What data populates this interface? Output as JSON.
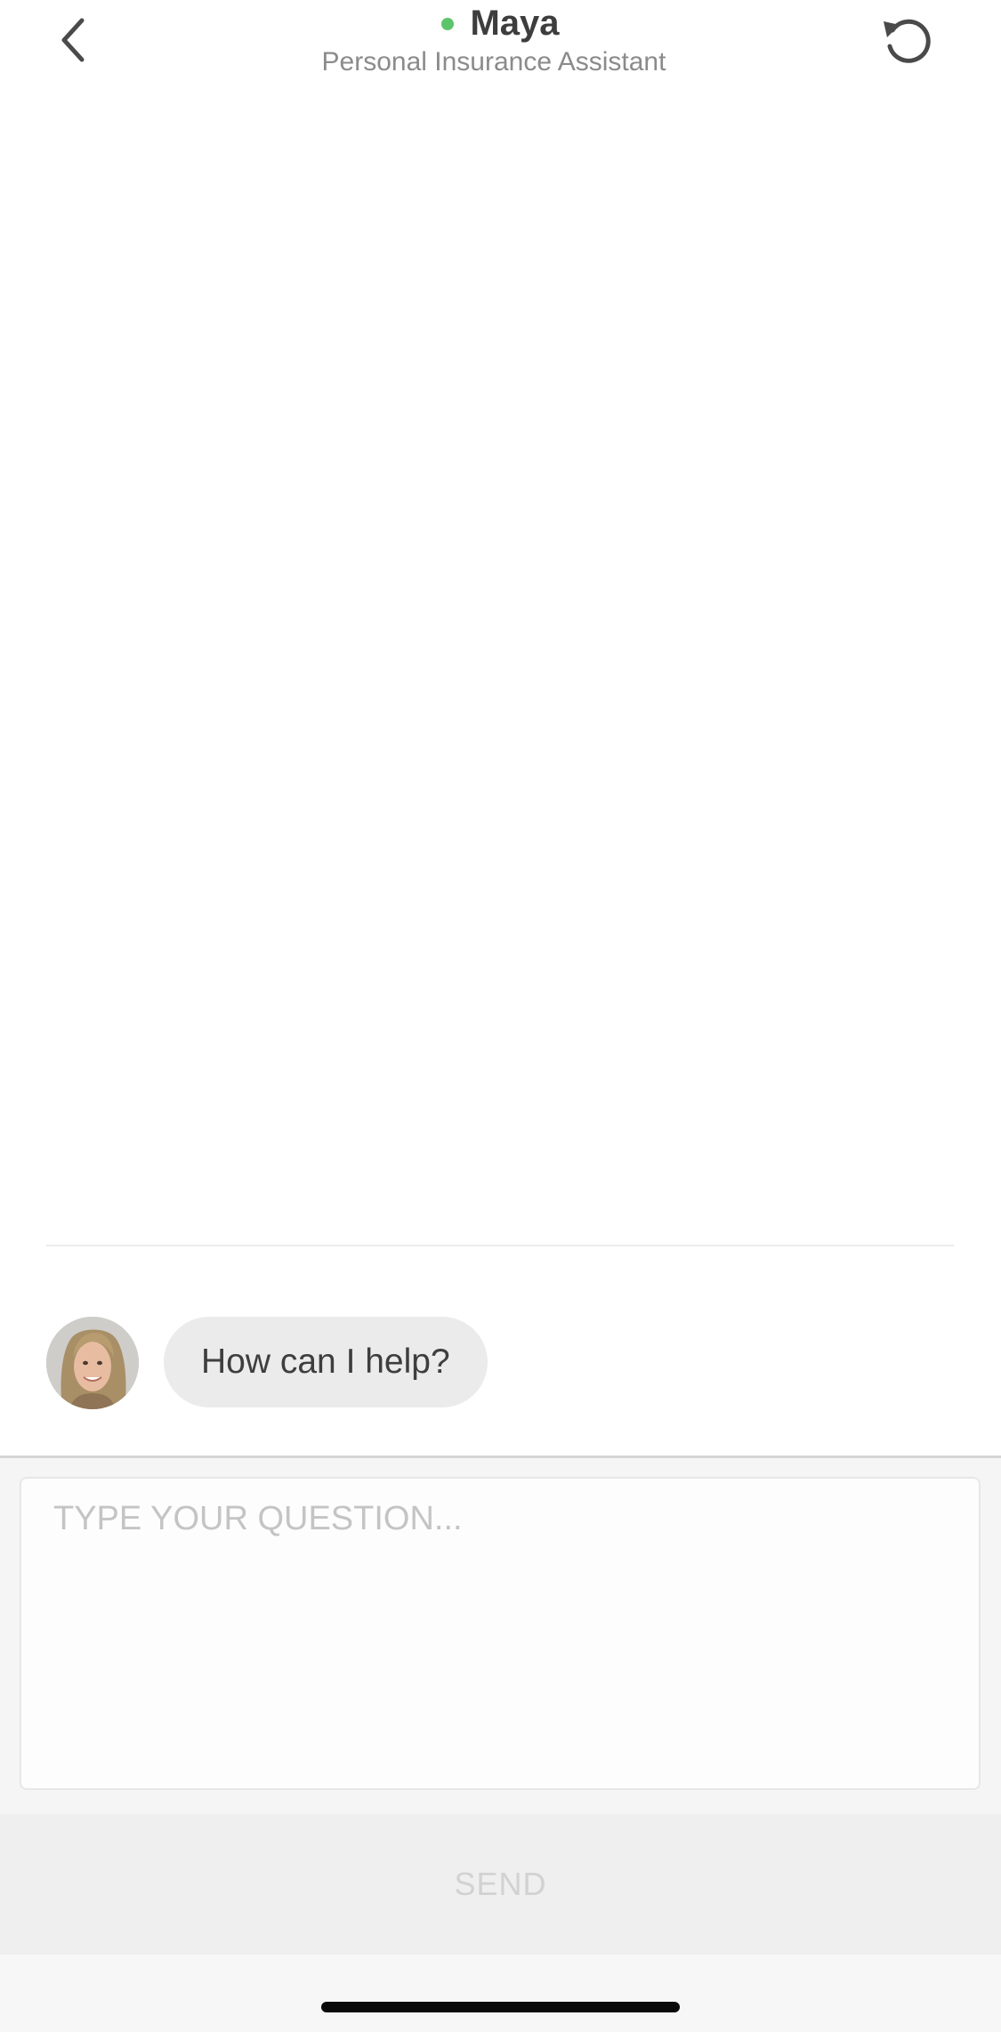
{
  "header": {
    "back_icon": "chevron-left-icon",
    "name": "Maya",
    "role": "Personal Insurance Assistant",
    "status_color": "#5cc46b",
    "refresh_icon": "refresh-icon"
  },
  "messages": [
    {
      "sender": "assistant",
      "avatar_icon": "avatar-photo",
      "text": "How can I help?"
    }
  ],
  "composer": {
    "placeholder": "TYPE YOUR QUESTION...",
    "value": "",
    "send_label": "SEND"
  },
  "colors": {
    "status_online": "#5cc46b",
    "bubble_bg": "#ebebeb",
    "send_disabled_text": "#d2d2d2"
  }
}
